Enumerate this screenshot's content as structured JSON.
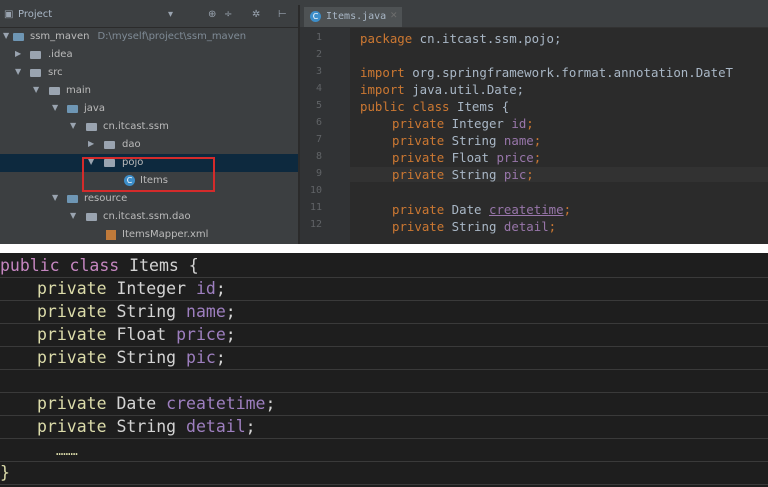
{
  "project_panel": {
    "title": "Project",
    "tree": [
      {
        "label": "ssm_maven",
        "path": "D:\\myself\\project\\ssm_maven"
      },
      {
        "label": ".idea"
      },
      {
        "label": "src"
      },
      {
        "label": "main"
      },
      {
        "label": "java"
      },
      {
        "label": "cn.itcast.ssm"
      },
      {
        "label": "dao"
      },
      {
        "label": "pojo"
      },
      {
        "label": "Items"
      },
      {
        "label": "resource"
      },
      {
        "label": "cn.itcast.ssm.dao"
      },
      {
        "label": "ItemsMapper.xml"
      }
    ]
  },
  "editor": {
    "tab_label": "Items.java",
    "line_numbers": [
      "1",
      "2",
      "3",
      "4",
      "5",
      "6",
      "7",
      "8",
      "9",
      "10",
      "11",
      "12"
    ],
    "lines": {
      "l1_kw": "package",
      "l1_rest": " cn.itcast.ssm.pojo;",
      "l3_kw": "import",
      "l3_rest": " org.springframework.format.annotation.DateT",
      "l4_kw": "import",
      "l4_rest": " java.util.Date;",
      "l5_kw": "public class",
      "l5_rest": " Items {",
      "l6_kw": "private",
      "l6_type": " Integer ",
      "l6_field": "id",
      "l6_end": ";",
      "l7_kw": "private",
      "l7_type": " String ",
      "l7_field": "name",
      "l7_end": ";",
      "l8_kw": "private",
      "l8_type": " Float ",
      "l8_field": "price",
      "l8_end": ";",
      "l9_kw": "private",
      "l9_type": " String ",
      "l9_field": "pic",
      "l9_end": ";",
      "l11_kw": "private",
      "l11_type": " Date ",
      "l11_field": "createtime",
      "l11_end": ";",
      "l12_kw": "private",
      "l12_type": " String ",
      "l12_field": "detail",
      "l12_end": ";"
    }
  },
  "code_block": {
    "line1_kw": "public class",
    "line1_rest": " Items {",
    "line2_kw": "private",
    "line2_type": " Integer ",
    "line2_field": "id",
    "line2_end": ";",
    "line3_kw": "private",
    "line3_type": " String ",
    "line3_field": "name",
    "line3_end": ";",
    "line4_kw": "private",
    "line4_type": " Float ",
    "line4_field": "price",
    "line4_end": ";",
    "line5_kw": "private",
    "line5_type": " String ",
    "line5_field": "pic",
    "line5_end": ";",
    "line7_kw": "private",
    "line7_type": " Date ",
    "line7_field": "createtime",
    "line7_end": ";",
    "line8_kw": "private",
    "line8_type": " String ",
    "line8_field": "detail",
    "line8_end": ";",
    "ellipsis": "………",
    "closing": "}"
  },
  "colors": {
    "keyword": "#cc7832",
    "field": "#9876aa",
    "highlight_box": "#d42b2b"
  }
}
